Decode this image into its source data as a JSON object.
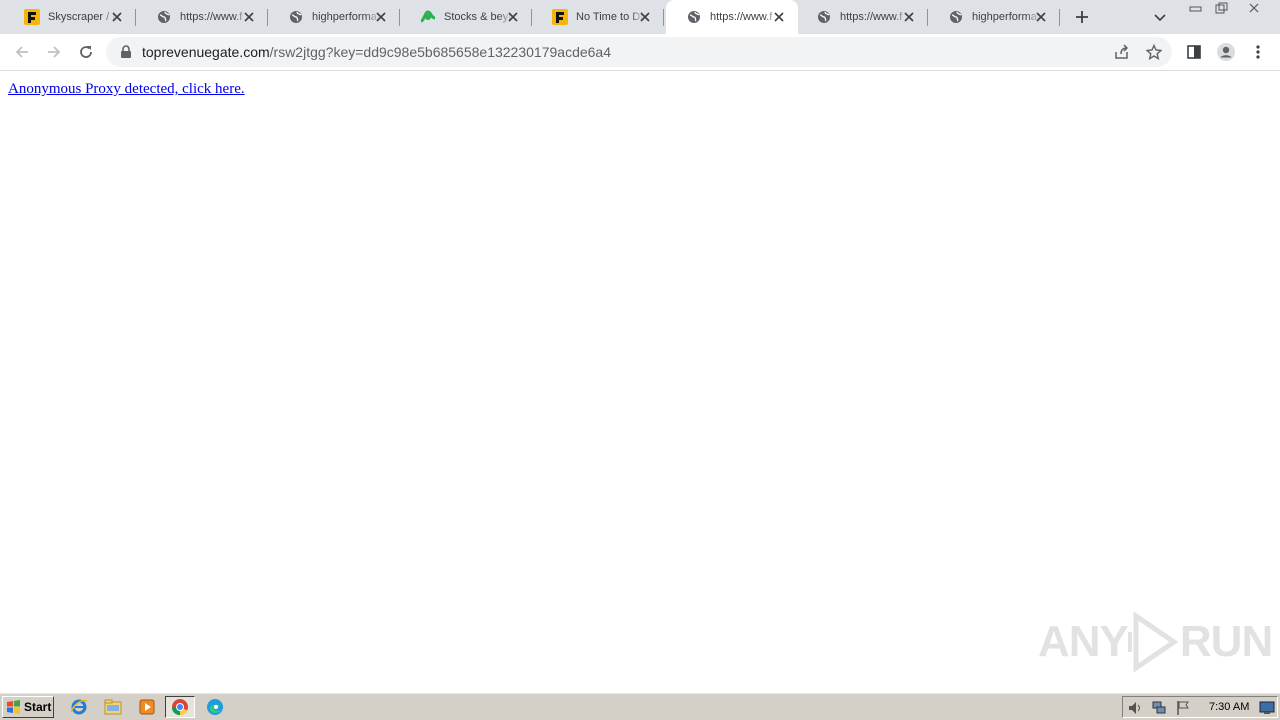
{
  "tabs": [
    {
      "title": "Skyscraper / H",
      "favicon": "f-logo-icon",
      "active": false
    },
    {
      "title": "https://www.f",
      "favicon": "globe-icon",
      "active": false
    },
    {
      "title": "highperforman",
      "favicon": "globe-icon",
      "active": false
    },
    {
      "title": "Stocks & beyo",
      "favicon": "stocks-logo-icon",
      "active": false
    },
    {
      "title": "No Time to Die",
      "favicon": "f-logo-icon",
      "active": false
    },
    {
      "title": "https://www.f",
      "favicon": "globe-icon",
      "active": true
    },
    {
      "title": "https://www.f",
      "favicon": "globe-icon",
      "active": false
    },
    {
      "title": "highperforman",
      "favicon": "globe-icon",
      "active": false
    }
  ],
  "address_bar": {
    "domain": "toprevenuegate.com",
    "path": "/rsw2jtgg?key=dd9c98e5b685658e132230179acde6a4"
  },
  "page": {
    "link_text": "Anonymous Proxy detected, click here."
  },
  "watermark": {
    "left": "ANY",
    "right": "RUN"
  },
  "taskbar": {
    "start_label": "Start",
    "clock": "7:30 AM"
  },
  "colors": {
    "tabstrip_bg": "#dee1e6",
    "link": "#0000ee",
    "taskbar_bg": "#d4d0c8"
  }
}
